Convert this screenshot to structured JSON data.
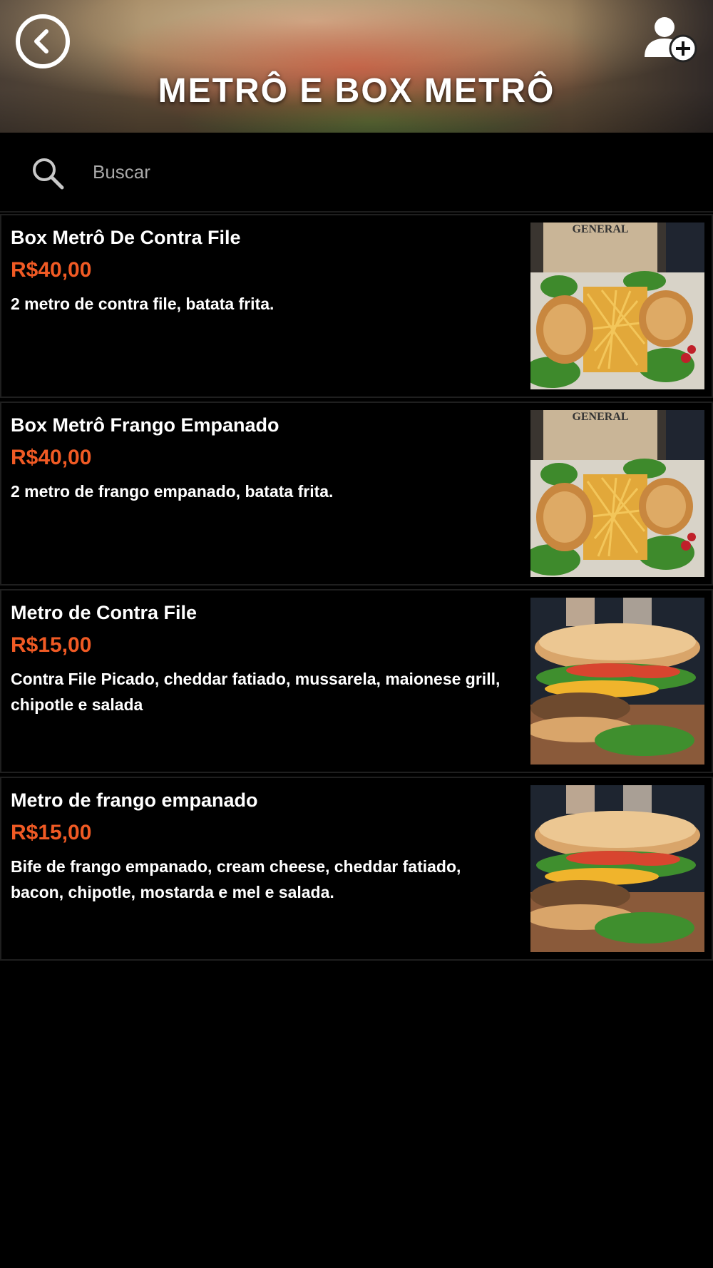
{
  "header": {
    "title": "METRÔ E BOX METRÔ",
    "back_icon": "back-arrow-circle-icon",
    "user_icon": "user-add-icon"
  },
  "search": {
    "placeholder": "Buscar",
    "value": "",
    "icon": "search-icon"
  },
  "colors": {
    "background": "#000000",
    "price": "#f05a24",
    "text": "#ffffff",
    "placeholder": "#a8a8a8"
  },
  "products": [
    {
      "name": "Box Metrô De Contra File",
      "price": "R$40,00",
      "description": "2 metro de contra file, batata frita.",
      "image": "box-food-photo"
    },
    {
      "name": "Box Metrô Frango Empanado",
      "price": "R$40,00",
      "description": "2 metro de frango empanado, batata frita.",
      "image": "box-food-photo"
    },
    {
      "name": "Metro de Contra File",
      "price": "R$15,00",
      "description": "Contra File Picado, cheddar fatiado, mussarela, maionese grill, chipotle e salada",
      "image": "sandwich-photo"
    },
    {
      "name": "Metro de frango empanado",
      "price": "R$15,00",
      "description": "Bife de frango empanado, cream cheese, cheddar fatiado, bacon, chipotle, mostarda e mel e salada.",
      "image": "sandwich-photo"
    }
  ]
}
